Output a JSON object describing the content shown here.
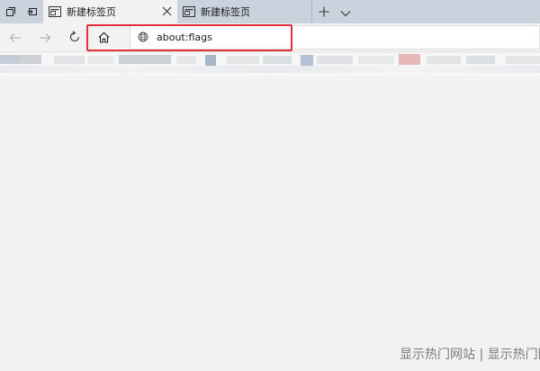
{
  "tabs": [
    {
      "label": "新建标签页",
      "active": true
    },
    {
      "label": "新建标签页",
      "active": false
    }
  ],
  "tab_strip": {
    "icons": [
      "tab-preview-icon",
      "set-tabs-aside-icon",
      "new-tab-plus-icon",
      "chevron-down-icon"
    ]
  },
  "nav": {
    "icons": [
      "back-arrow-icon",
      "forward-arrow-icon",
      "refresh-icon",
      "home-icon"
    ]
  },
  "address_bar": {
    "url": "about:flags",
    "icon": "globe-icon"
  },
  "favorites_bar": {
    "state": "pixelated"
  },
  "watermark": {
    "text": "显示热门网站 | 显示热门网站"
  },
  "colors": {
    "highlight": "#e0303a",
    "tabstrip": "#c9d2dd",
    "background": "#f2f2f2"
  }
}
